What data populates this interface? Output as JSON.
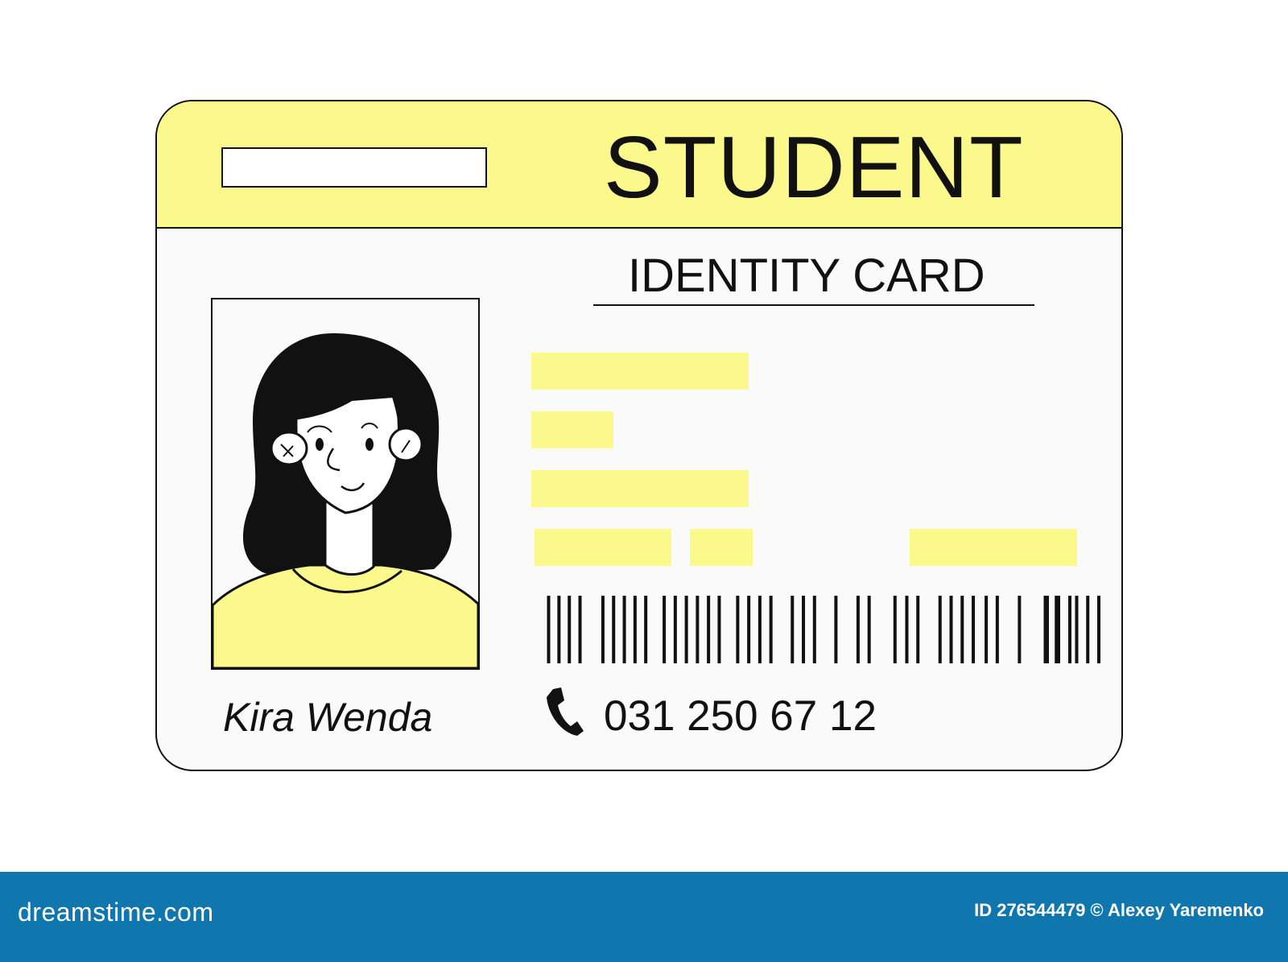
{
  "card": {
    "title": "STUDENT",
    "subtitle": "IDENTITY CARD",
    "name": "Kira Wenda",
    "phone": "031 250 67 12",
    "phone_icon": "phone-icon"
  },
  "colors": {
    "accent_yellow": "#fcf98c",
    "footer_blue": "#0f77ae",
    "card_bg": "#fafafa"
  },
  "footer": {
    "logo": "dreamstime.com",
    "credit": "ID 276544479 © Alexey Yaremenko"
  }
}
